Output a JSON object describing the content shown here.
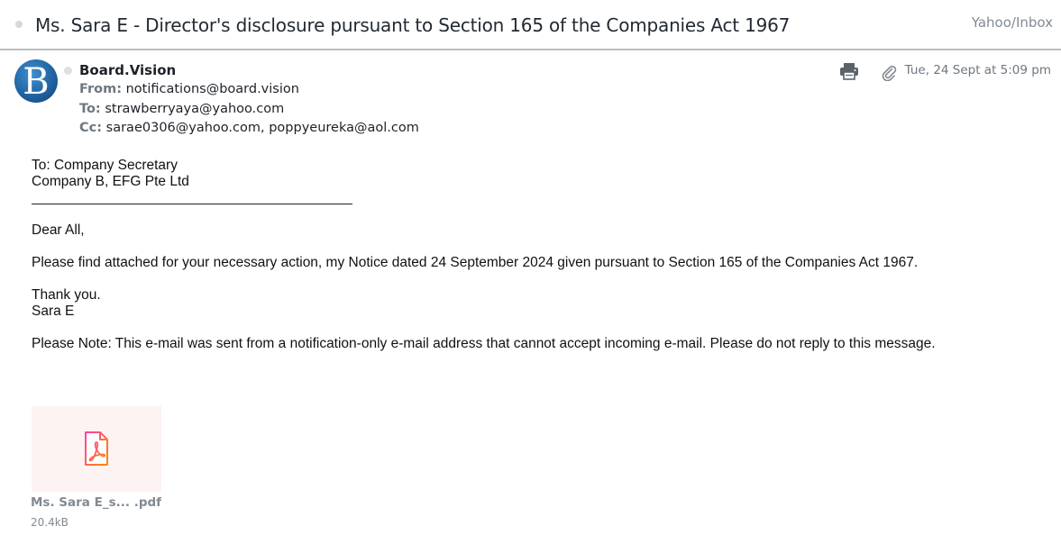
{
  "header": {
    "subject": "Ms. Sara E - Director's disclosure pursuant to Section 165 of the Companies Act 1967",
    "folder": "Yahoo/Inbox"
  },
  "message": {
    "sender_name": "Board.Vision",
    "avatar_letter": "B",
    "from_label": "From:",
    "from": "notifications@board.vision",
    "to_label": "To:",
    "to": "strawberryaya@yahoo.com",
    "cc_label": "Cc:",
    "cc": "sarae0306@yahoo.com,  poppyeureka@aol.com",
    "date": "Tue, 24 Sept at 5:09 pm"
  },
  "icons": {
    "print": "print-icon",
    "attachment": "paperclip-icon",
    "pdf": "pdf-file-icon"
  },
  "body": {
    "to_line1": "To: Company Secretary",
    "to_line2": "Company B, EFG Pte Ltd",
    "greeting": "Dear All,",
    "paragraph": "Please find attached for your necessary action, my Notice dated 24 September 2024 given pursuant to Section 165 of the Companies Act 1967.",
    "thanks": "Thank you.",
    "signature": "Sara E",
    "note": "Please Note: This e-mail was sent from a notification-only e-mail address that cannot accept incoming e-mail. Please do not reply to this message."
  },
  "attachment": {
    "name": "Ms. Sara E_s... .pdf",
    "size": "20.4kB"
  },
  "colors": {
    "avatar_blue": "#1f5f9e",
    "pdf_gradient_start": "#ff4da6",
    "pdf_gradient_end": "#ff8a00",
    "attachment_bg": "#fdf3f2"
  }
}
